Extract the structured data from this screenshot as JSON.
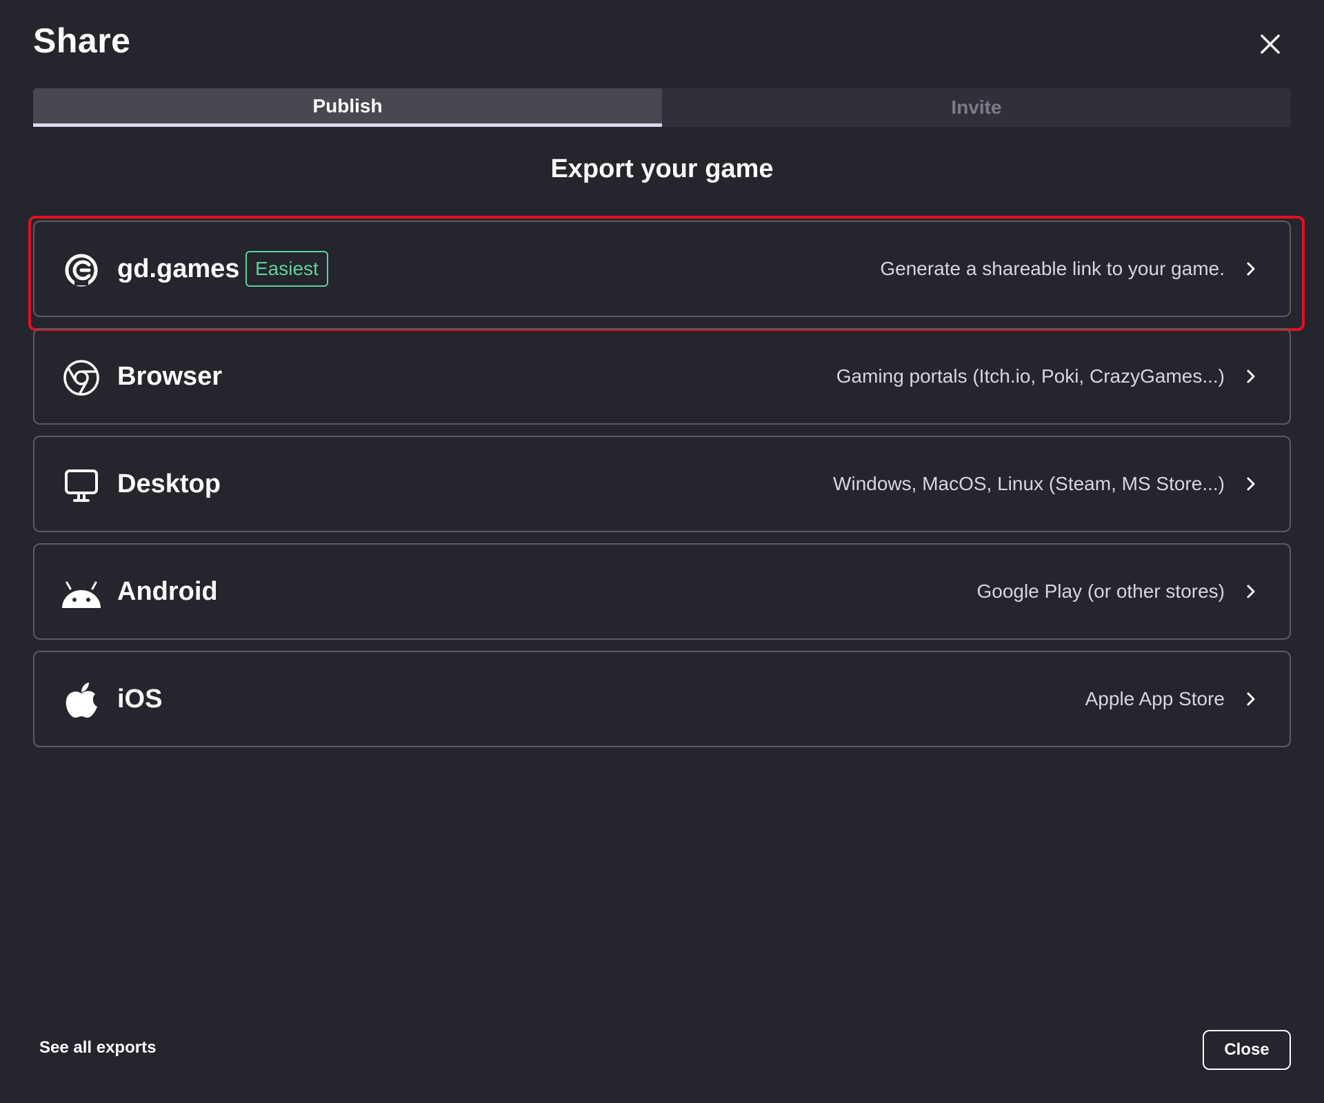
{
  "dialog": {
    "title": "Share",
    "close_icon": "close-icon"
  },
  "tabs": [
    {
      "label": "Publish",
      "active": true
    },
    {
      "label": "Invite",
      "active": false
    }
  ],
  "section_title": "Export your game",
  "options": [
    {
      "label": "gd.games",
      "badge": "Easiest",
      "description": "Generate a shareable link to your game.",
      "icon": "gdgames-logo-icon",
      "highlighted": true
    },
    {
      "label": "Browser",
      "description": "Gaming portals (Itch.io, Poki, CrazyGames...)",
      "icon": "browser-icon"
    },
    {
      "label": "Desktop",
      "description": "Windows, MacOS, Linux (Steam, MS Store...)",
      "icon": "desktop-monitor-icon"
    },
    {
      "label": "Android",
      "description": "Google Play (or other stores)",
      "icon": "android-icon"
    },
    {
      "label": "iOS",
      "description": "Apple App Store",
      "icon": "apple-icon"
    }
  ],
  "footer": {
    "see_all_label": "See all exports",
    "close_label": "Close"
  },
  "colors": {
    "background": "#25252e",
    "tab_active": "#484852",
    "tab_inactive": "#30303a",
    "badge_green": "#5fd39b",
    "highlight_red": "#e3101f",
    "border": "#5b5b66"
  }
}
